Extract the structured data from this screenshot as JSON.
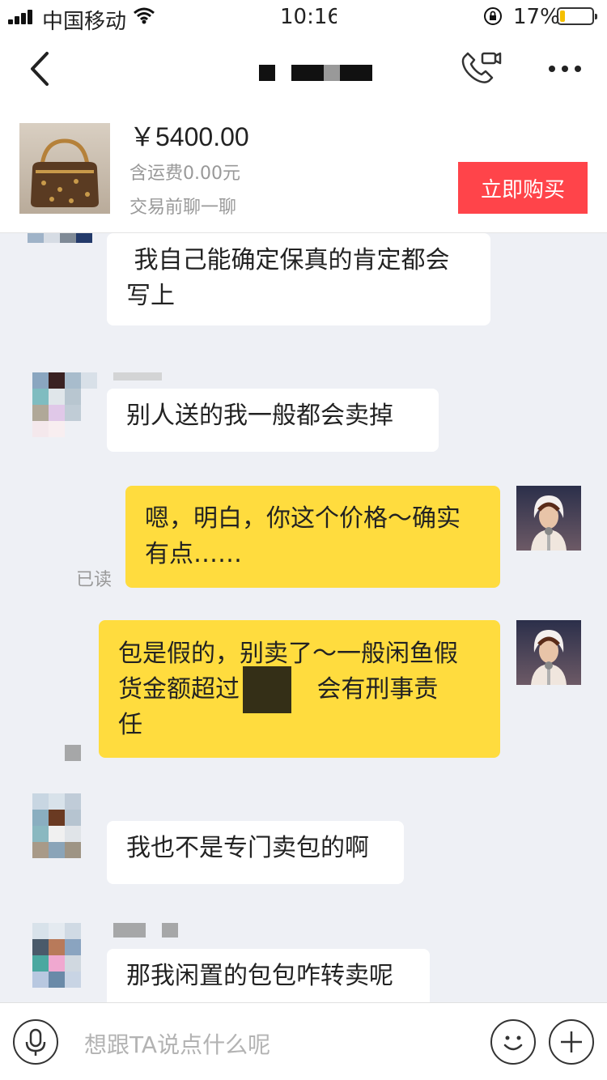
{
  "status_bar": {
    "carrier": "中国移动",
    "time": "10:16",
    "battery_percent": "17%",
    "battery_level": 0.17
  },
  "nav": {
    "title": ""
  },
  "product": {
    "price": "￥5400.00",
    "shipping": "含运费0.00元",
    "prompt": "交易前聊一聊",
    "buy_label": "立即购买"
  },
  "messages": [
    {
      "side": "left",
      "text": " 我自己能确定保真的肯定都会\n写上"
    },
    {
      "side": "left",
      "text": "别人送的我一般都会卖掉"
    },
    {
      "side": "right",
      "text": "嗯，明白，你这个价格～确实\n有点……",
      "read": "已读"
    },
    {
      "side": "right",
      "text": "包是假的，别卖了～一般闲鱼假\n货金额超过          会有刑事责\n任"
    },
    {
      "side": "left",
      "text": "我也不是专门卖包的啊"
    },
    {
      "side": "left",
      "text": "那我闲置的包包咋转卖呢"
    }
  ],
  "input": {
    "placeholder": "想跟TA说点什么呢"
  },
  "colors": {
    "accent": "#ff444a",
    "my_bubble": "#ffdc3e",
    "their_bubble": "#ffffff",
    "background": "#eef0f5"
  },
  "icons": [
    "signal-icon",
    "wifi-icon",
    "rotation-lock-icon",
    "battery-icon",
    "back-icon",
    "video-call-icon",
    "more-icon",
    "microphone-icon",
    "emoji-icon",
    "plus-icon"
  ]
}
